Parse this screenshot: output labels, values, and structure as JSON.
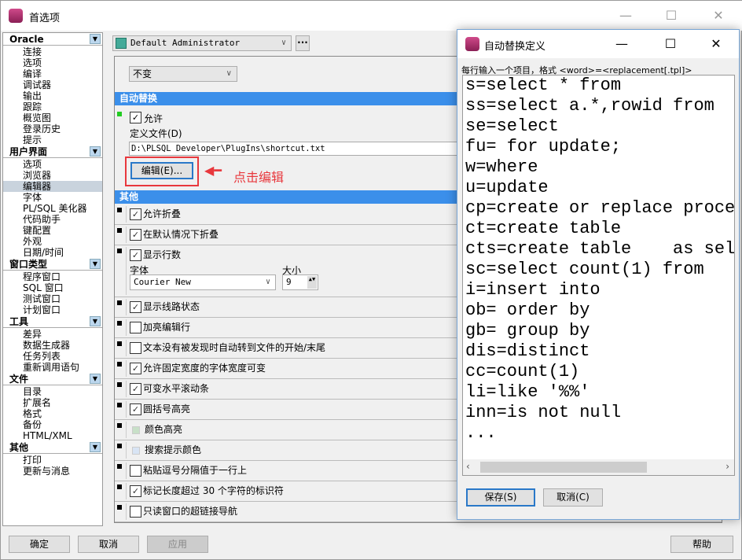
{
  "window": {
    "title": "首选项"
  },
  "sidebar": {
    "groups": [
      {
        "label": "Oracle",
        "items": [
          "连接",
          "选项",
          "编译",
          "调试器",
          "输出",
          "跟踪",
          "概览图",
          "登录历史",
          "提示"
        ]
      },
      {
        "label": "用户界面",
        "items": [
          "选项",
          "浏览器",
          "编辑器",
          "字体",
          "PL/SQL 美化器",
          "代码助手",
          "键配置",
          "外观",
          "日期/时间"
        ],
        "selected": "编辑器"
      },
      {
        "label": "窗口类型",
        "items": [
          "程序窗口",
          "SQL 窗口",
          "测试窗口",
          "计划窗口"
        ]
      },
      {
        "label": "工具",
        "items": [
          "差异",
          "数据生成器",
          "任务列表",
          "重新调用语句"
        ]
      },
      {
        "label": "文件",
        "items": [
          "目录",
          "扩展名",
          "格式",
          "备份",
          "HTML/XML"
        ]
      },
      {
        "label": "其他",
        "items": [
          "打印",
          "更新与消息"
        ]
      }
    ]
  },
  "profile": {
    "value": "Default Administrator",
    "more": "···"
  },
  "main": {
    "case_value": "不变",
    "autoreplace": {
      "header": "自动替换",
      "allow_label": "允许",
      "allow_checked": true,
      "file_label": "定义文件(D)",
      "file_value": "D:\\PLSQL Developer\\PlugIns\\shortcut.txt",
      "edit_button": "编辑(E)...",
      "annotation": "点击编辑"
    },
    "other": {
      "header": "其他",
      "options": [
        {
          "label": "允许折叠",
          "checked": true
        },
        {
          "label": "在默认情况下折叠",
          "checked": true
        },
        {
          "label": "显示行数",
          "checked": true
        },
        {
          "label": "显示线路状态",
          "checked": true
        },
        {
          "label": "加亮编辑行",
          "checked": false
        },
        {
          "label": "文本没有被发现时自动转到文件的开始/末尾",
          "checked": false
        },
        {
          "label": "允许固定宽度的字体宽度可变",
          "checked": true
        },
        {
          "label": "可变水平滚动条",
          "checked": true
        },
        {
          "label": "圆括号高亮",
          "checked": true
        },
        {
          "label": "颜色高亮",
          "color": "#c8e0c8"
        },
        {
          "label": "搜索提示颜色",
          "color": "#d8e4f4"
        },
        {
          "label": "粘贴逗号分隔值于一行上",
          "checked": false
        },
        {
          "label": "标记长度超过 30 个字符的标识符",
          "checked": true
        },
        {
          "label": "只读窗口的超链接导航",
          "checked": false
        }
      ],
      "font_label": "字体",
      "font_value": "Courier New",
      "size_label": "大小",
      "size_value": "9"
    }
  },
  "footer": {
    "ok": "确定",
    "cancel": "取消",
    "apply": "应用",
    "help": "帮助"
  },
  "dialog": {
    "title": "自动替换定义",
    "hint": "每行输入一个项目，格式 <word>=<replacement[.tpl]>",
    "lines": [
      "s=select * from",
      "ss=select a.*,rowid from",
      "se=select",
      "fu= for update;",
      "w=where",
      "u=update",
      "cp=create or replace procedure",
      "ct=create table",
      "cts=create table    as select",
      "sc=select count(1) from",
      "i=insert into",
      "ob= order by",
      "gb= group by",
      "dis=distinct",
      "cc=count(1)",
      "li=like '%%'",
      "inn=is not null",
      "..."
    ],
    "save": "保存(S)",
    "cancel": "取消(C)"
  },
  "colors": {
    "section": "#3b8fea",
    "annotation": "#e8383d",
    "selected": "#c9d3dd"
  }
}
